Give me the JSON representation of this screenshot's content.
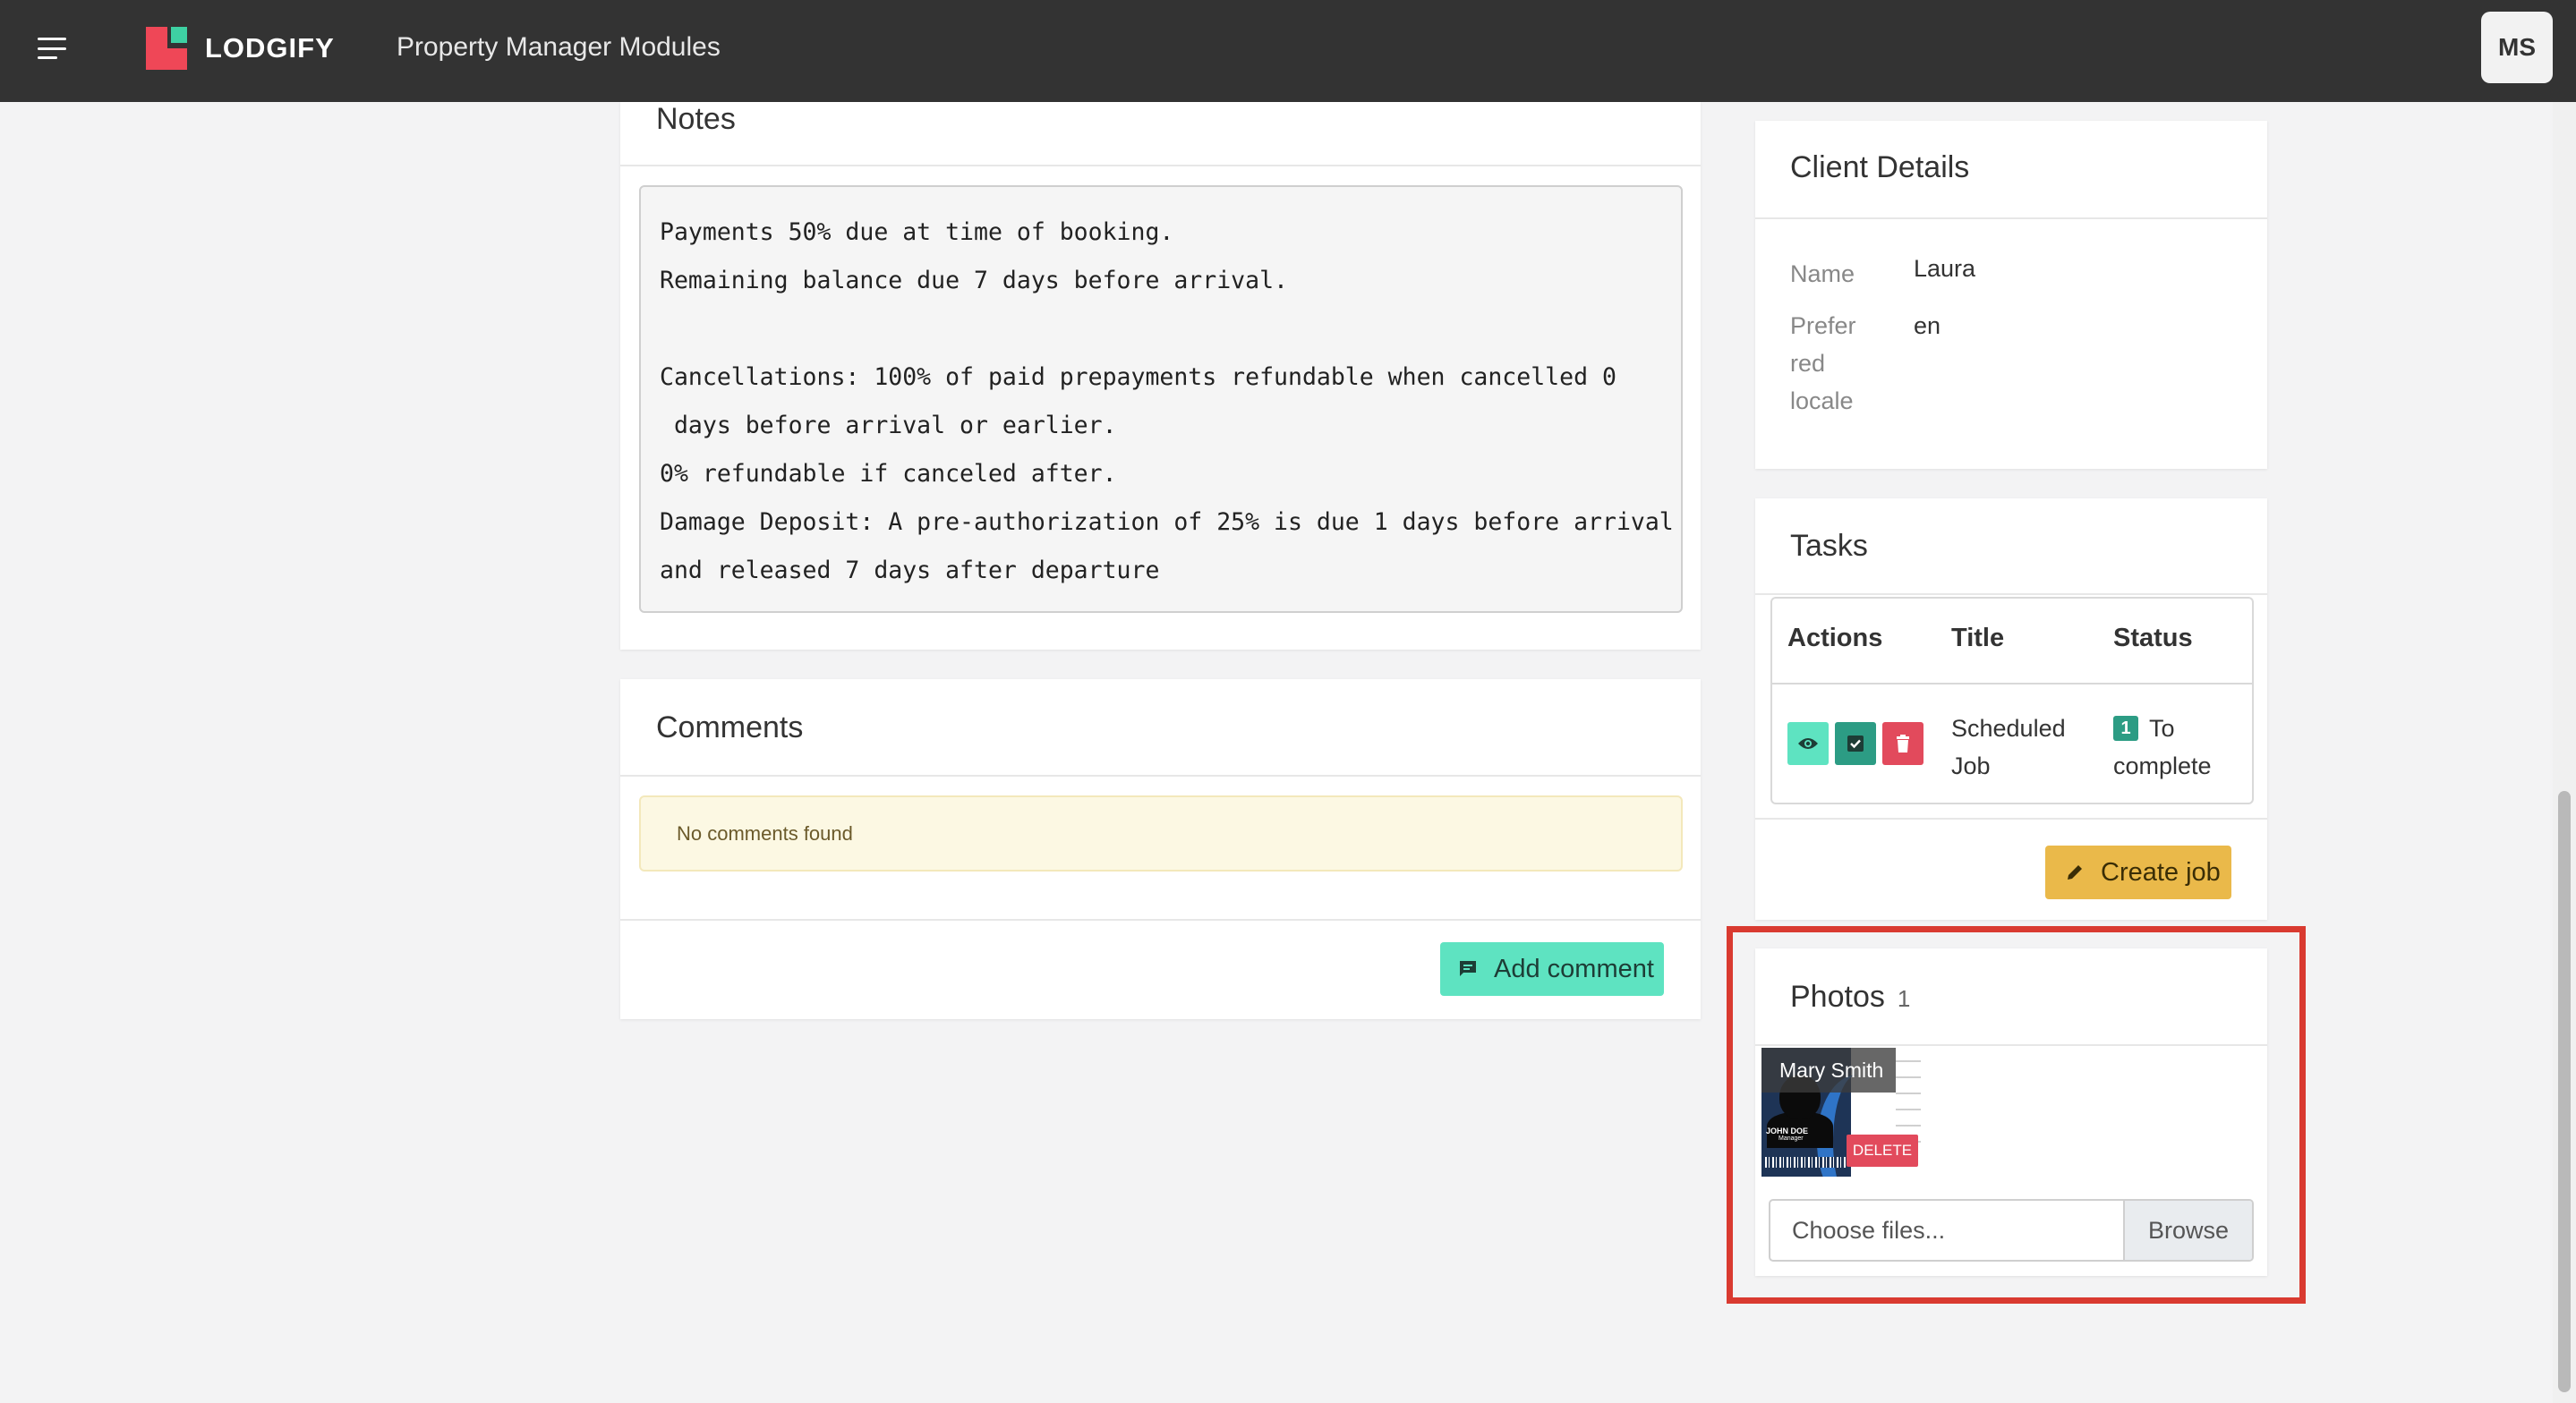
{
  "topbar": {
    "logo_text": "LODGIFY",
    "app_title": "Property Manager Modules",
    "avatar_initials": "MS"
  },
  "notes": {
    "title": "Notes",
    "lines": [
      "Payments 50% due at time of booking.",
      "Remaining balance due 7 days before arrival.",
      "",
      "Cancellations: 100% of paid prepayments refundable when cancelled 0",
      " days before arrival or earlier.",
      "0% refundable if canceled after.",
      "Damage Deposit: A pre-authorization of 25% is due 1 days before arrival",
      "and released 7 days after departure"
    ]
  },
  "comments": {
    "title": "Comments",
    "empty_text": "No comments found",
    "add_label": "Add comment"
  },
  "client": {
    "title": "Client Details",
    "name_label": "Name",
    "name_value": "Laura",
    "locale_label_lines": [
      "Prefer",
      "red",
      "locale"
    ],
    "locale_value": "en"
  },
  "tasks": {
    "title": "Tasks",
    "columns": [
      "Actions",
      "Title",
      "Status"
    ],
    "rows": [
      {
        "title_lines": [
          "Scheduled",
          "Job"
        ],
        "status_badge": "1",
        "status_lines": [
          "To",
          "complete"
        ]
      }
    ],
    "create_label": "Create job"
  },
  "photos": {
    "title": "Photos",
    "count": "1",
    "items": [
      {
        "caption": "Mary Smith",
        "delete_label": "DELETE",
        "id_name": "JOHN DOE",
        "id_role": "Manager"
      }
    ],
    "file_placeholder": "Choose files...",
    "browse_label": "Browse"
  },
  "colors": {
    "topbar": "#333333",
    "teal": "#5ee3c1",
    "danger": "#e24a5c",
    "warning": "#eab94a",
    "highlight": "#d93a30"
  }
}
